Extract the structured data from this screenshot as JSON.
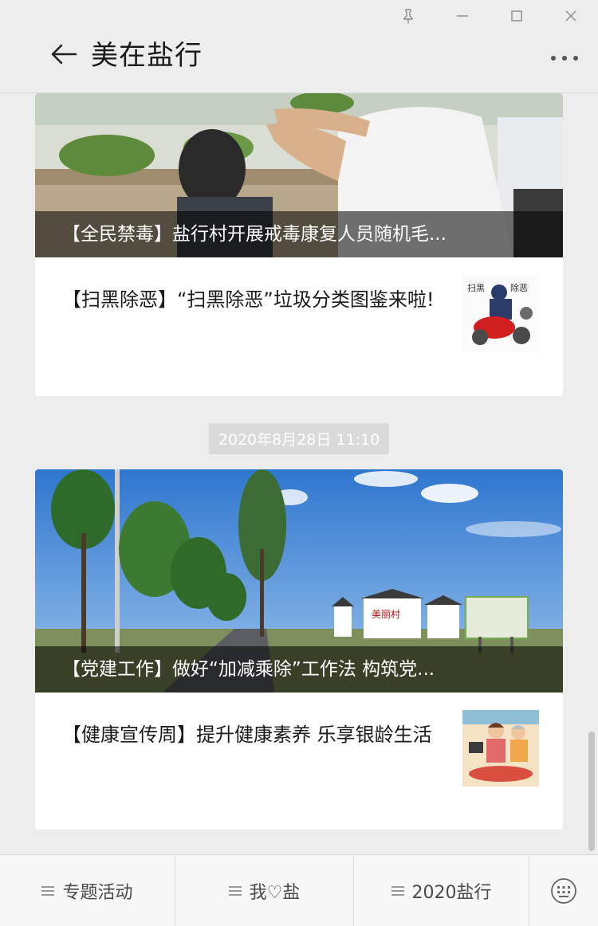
{
  "window": {
    "controls": [
      "pin",
      "minimize",
      "maximize",
      "close"
    ]
  },
  "header": {
    "title": "美在盐行",
    "back_icon": "arrow-left-icon",
    "more_icon": "more-dots-icon"
  },
  "messages": [
    {
      "cover_caption": "【全民禁毒】盐行村开展戒毒康复人员随机毛...",
      "sub_title": "【扫黑除恶】“扫黑除恶”垃圾分类图鉴来啦!"
    },
    {
      "timestamp": "2020年8月28日 11:10",
      "cover_caption": "【党建工作】做好“加减乘除”工作法 构筑党...",
      "sub_title": "【健康宣传周】提升健康素养 乐享银龄生活"
    }
  ],
  "thumb_text": {
    "left": "扫黑",
    "right": "除恶",
    "sign": "美丽村"
  },
  "bottom_menu": [
    {
      "label": "专题活动"
    },
    {
      "label": "我♡盐"
    },
    {
      "label": "2020盐行"
    }
  ],
  "colors": {
    "background": "#ededed",
    "card": "#ffffff",
    "caption_overlay": "rgba(0,0,0,0.55)",
    "timestamp_bg": "#dadada"
  }
}
